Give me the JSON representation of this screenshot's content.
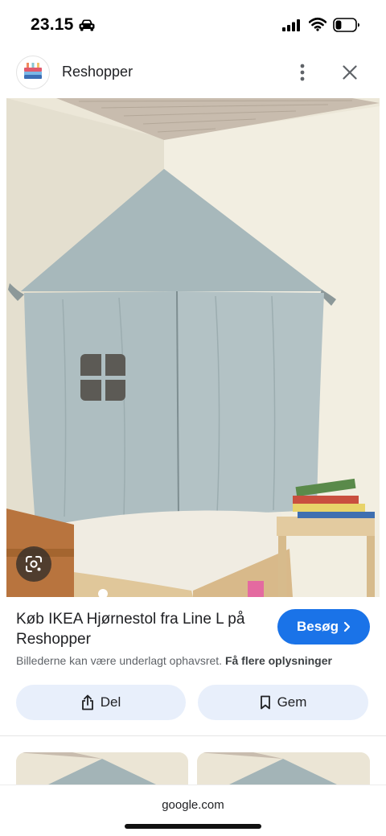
{
  "status_bar": {
    "time": "23.15",
    "icons": [
      "car-icon",
      "cellular-signal-icon",
      "wifi-icon",
      "battery-icon"
    ],
    "battery_level": 0.3
  },
  "header": {
    "site_name": "Reshopper",
    "logo_icon": "reshopper-logo",
    "more_icon": "more-vertical-icon",
    "close_icon": "close-icon"
  },
  "image": {
    "lens_icon": "google-lens-icon"
  },
  "result": {
    "title": "Køb IKEA Hjørnestol fra Line L på Reshopper",
    "visit_label": "Besøg",
    "copyright_text": "Billederne kan være underlagt ophavsret.",
    "more_info_label": "Få flere oplysninger"
  },
  "actions": {
    "share_label": "Del",
    "save_label": "Gem"
  },
  "footer": {
    "url": "google.com"
  },
  "colors": {
    "accent": "#1a73e8",
    "chip_bg": "#e8effb",
    "text": "#202124",
    "muted": "#5f6368"
  }
}
